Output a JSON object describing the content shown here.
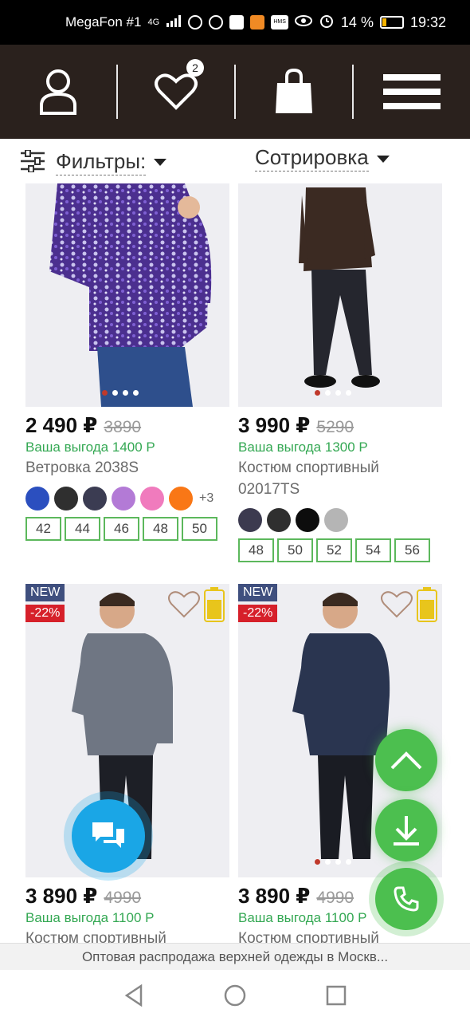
{
  "status_bar": {
    "carrier": "MegaFon #1",
    "network": "4G",
    "battery_percent": "14 %",
    "time": "19:32"
  },
  "nav": {
    "wishlist_count": "2"
  },
  "toolbar": {
    "filters_label": "Фильтры:",
    "sort_label": "Сотрировка"
  },
  "products": [
    {
      "price": "2 490 ₽",
      "old_price": "3890",
      "benefit": "Ваша выгода 1400 Р",
      "name": "Ветровка 2038S",
      "colors": [
        "#2b4fbf",
        "#2f2f2f",
        "#3b3c52",
        "#b37ad6",
        "#f07bbd",
        "#f97716"
      ],
      "more_colors": "+3",
      "sizes": [
        "42",
        "44",
        "46",
        "48",
        "50"
      ]
    },
    {
      "price": "3 990 ₽",
      "old_price": "5290",
      "benefit": "Ваша выгода 1300 Р",
      "name": "Костюм спортивный 02017TS",
      "colors": [
        "#3c3a4f",
        "#2f2f2f",
        "#0d0d0d",
        "#b5b5b5"
      ],
      "sizes": [
        "48",
        "50",
        "52",
        "54",
        "56"
      ]
    },
    {
      "badge_new": "NEW",
      "badge_discount": "-22%",
      "price": "3 890 ₽",
      "old_price": "4990",
      "benefit": "Ваша выгода 1100 Р",
      "name": "Костюм спортивный"
    },
    {
      "badge_new": "NEW",
      "badge_discount": "-22%",
      "price": "3 890 ₽",
      "old_price": "4990",
      "benefit": "Ваша выгода 1100 Р",
      "name": "Костюм спортивный"
    }
  ],
  "browser": {
    "page_title": "Оптовая распродажа верхней одежды в Москв..."
  },
  "icons": {
    "account": "person-icon",
    "wishlist": "heart-icon",
    "cart": "shopping-bag-icon",
    "menu": "hamburger-icon",
    "filter": "sliders-icon",
    "scroll_up": "chevron-up-icon",
    "download": "download-icon",
    "call": "phone-icon",
    "chat": "chat-icon"
  },
  "colors": {
    "nav_bg": "#2a211d",
    "benefit_green": "#34a853",
    "size_border": "#5cb85c",
    "new_badge": "#3f4f7e",
    "discount_badge": "#d6202a",
    "fab_green": "#4cbf4f",
    "chat_blue": "#1aa6e6"
  }
}
